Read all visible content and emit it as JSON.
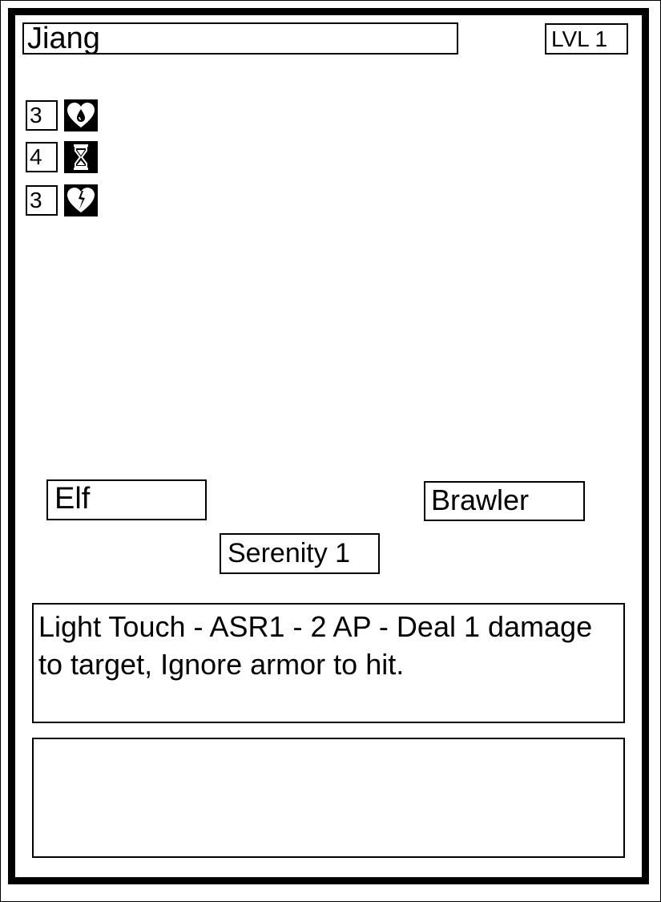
{
  "card": {
    "name": "Jiang",
    "level": "LVL 1",
    "stats": [
      {
        "value": "3",
        "icon": "heart-drop-icon"
      },
      {
        "value": "4",
        "icon": "hourglass-icon"
      },
      {
        "value": "3",
        "icon": "broken-heart-icon"
      }
    ],
    "race": "Elf",
    "class": "Brawler",
    "trait": "Serenity 1",
    "ability": "Light Touch - ASR1 - 2 AP - Deal 1 damage to target, Ignore armor to hit.",
    "flavor": "",
    "colors": {
      "ink": "#000000",
      "paper": "#ffffff"
    }
  }
}
